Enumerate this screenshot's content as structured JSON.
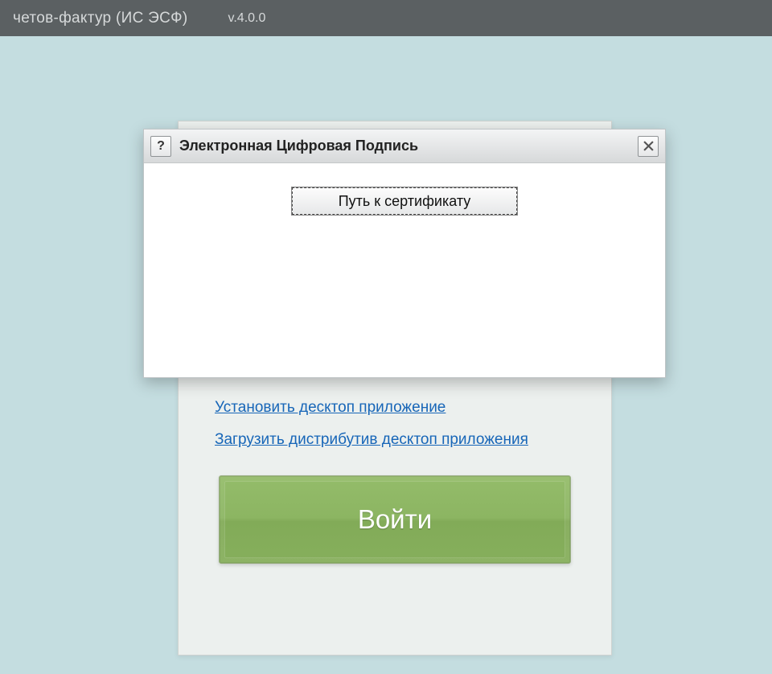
{
  "header": {
    "app_title": "четов-фактур (ИС ЭСФ)",
    "version": "v.4.0.0"
  },
  "login_card": {
    "links": {
      "install_desktop": "Установить десктоп приложение",
      "download_desktop": "Загрузить дистрибутив десктоп приложения"
    },
    "login_button": "Войти"
  },
  "dialog": {
    "title": "Электронная Цифровая Подпись",
    "help": "?",
    "cert_button": "Путь к сертификату"
  }
}
